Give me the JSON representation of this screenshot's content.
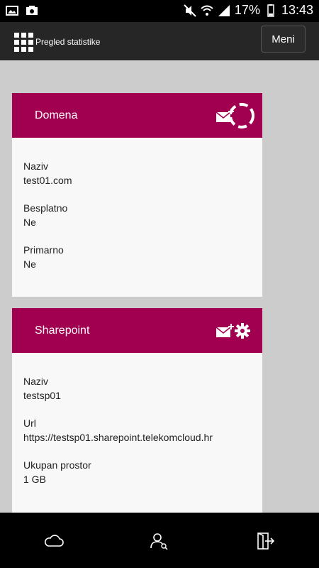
{
  "status_bar": {
    "battery_percent": "17%",
    "time": "13:43"
  },
  "app_bar": {
    "title": "Pregled statistike",
    "menu_label": "Meni"
  },
  "cards": [
    {
      "title": "Domena",
      "fields": [
        {
          "label": "Naziv",
          "value": "test01.com"
        },
        {
          "label": "Besplatno",
          "value": "Ne"
        },
        {
          "label": "Primarno",
          "value": "Ne"
        }
      ]
    },
    {
      "title": "Sharepoint",
      "fields": [
        {
          "label": "Naziv",
          "value": "testsp01"
        },
        {
          "label": "Url",
          "value": "https://testsp01.sharepoint.telekomcloud.hr"
        },
        {
          "label": "Ukupan prostor",
          "value": "1 GB"
        }
      ]
    }
  ],
  "bottom_nav": {
    "icons": [
      "cloud-icon",
      "user-search-icon",
      "logout-icon"
    ]
  },
  "colors": {
    "accent": "#a0004f",
    "app_bar": "#262626",
    "background": "#cccccc"
  }
}
